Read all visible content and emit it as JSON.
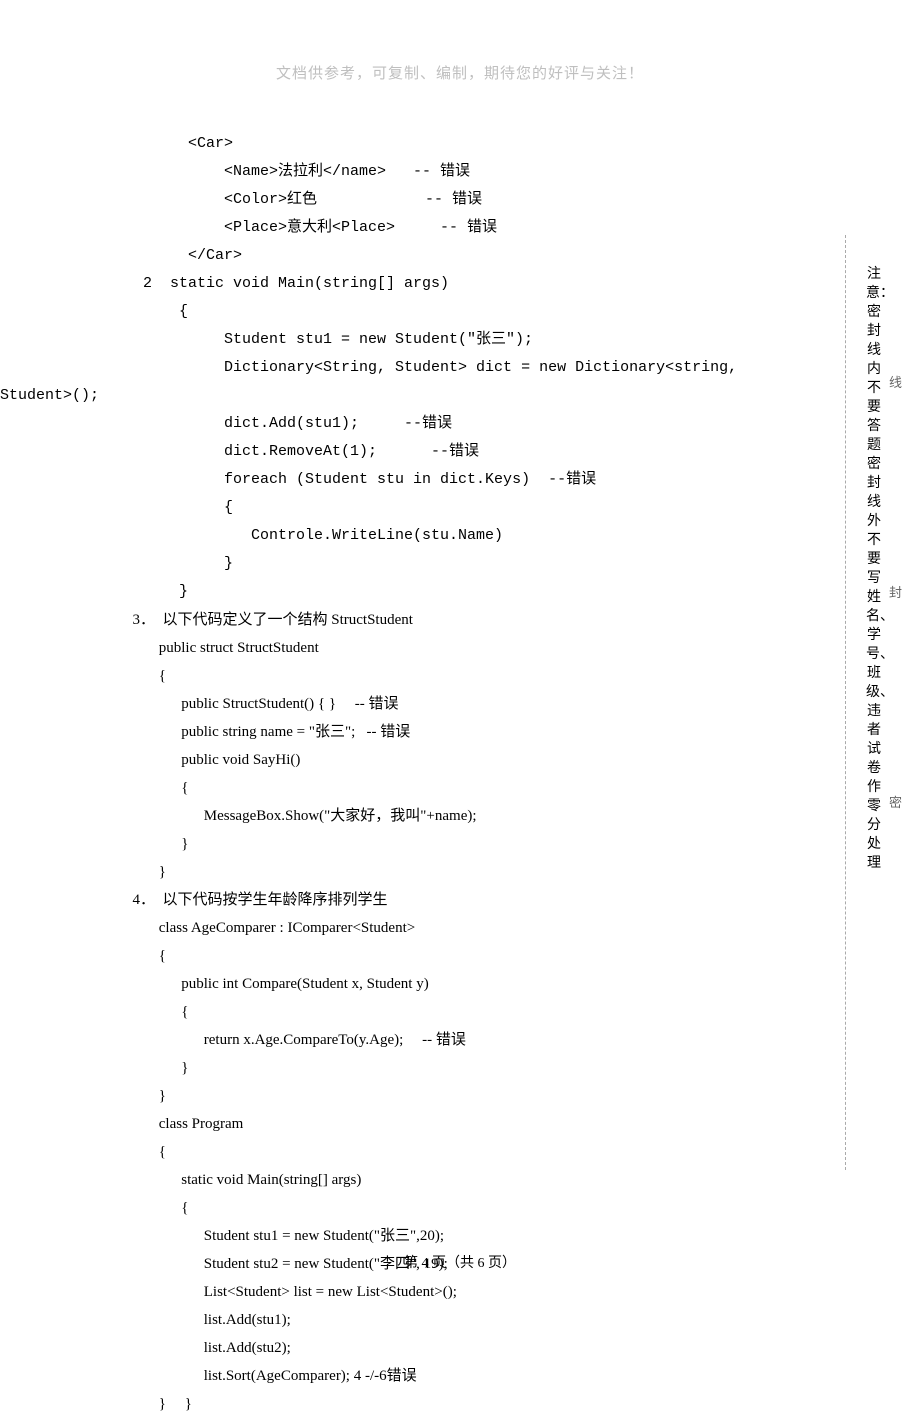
{
  "header": "文档供参考，可复制、编制，期待您的好评与关注！",
  "lines": [
    "       <Car>",
    "           <Name>法拉利</name>   -- 错误",
    "           <Color>红色            -- 错误",
    "           <Place>意大利<Place>     -- 错误",
    "       </Car>",
    "  2  static void Main(string[] args)",
    "      {",
    "           Student stu1 = new Student(\"张三\");",
    "           Dictionary<String, Student> dict = new Dictionary<string,",
    "Student>();",
    "           dict.Add(stu1);     --错误",
    "           dict.RemoveAt(1);      --错误",
    "           foreach (Student stu in dict.Keys)  --错误",
    "           {",
    "              Controle.WriteLine(stu.Name)",
    "           }",
    "      }",
    "  3．  以下代码定义了一个结构 StructStudent",
    "         public struct StructStudent",
    "         {",
    "               public StructStudent() { }     -- 错误",
    "               public string name = \"张三\";   -- 错误",
    "",
    "               public void SayHi()",
    "               {",
    "                     MessageBox.Show(\"大家好，我叫\"+name);",
    "               }",
    "         }",
    "  4．  以下代码按学生年龄降序排列学生",
    "         class AgeComparer : IComparer<Student>",
    "         {",
    "               public int Compare(Student x, Student y)",
    "               {",
    "                     return x.Age.CompareTo(y.Age);     -- 错误",
    "               }",
    "         }",
    "         class Program",
    "         {",
    "               static void Main(string[] args)",
    "               {",
    "                     Student stu1 = new Student(\"张三\",20);",
    "                     Student stu2 = new Student(\"李四\", 19);",
    "                     List<Student> list = new List<Student>();",
    "                     list.Add(stu1);",
    "                     list.Add(stu2);",
    "                     list.Sort(AgeComparer); 4 -/-6错误",
    "         }     }"
  ],
  "footer": "第 4 页（共 6 页）",
  "sidebar": "注意：密封线内不要答题 密封线外不要写姓名、学号、班级、违者试卷作零分处理",
  "markers": {
    "top": "线",
    "mid": "封",
    "bot": "密"
  }
}
